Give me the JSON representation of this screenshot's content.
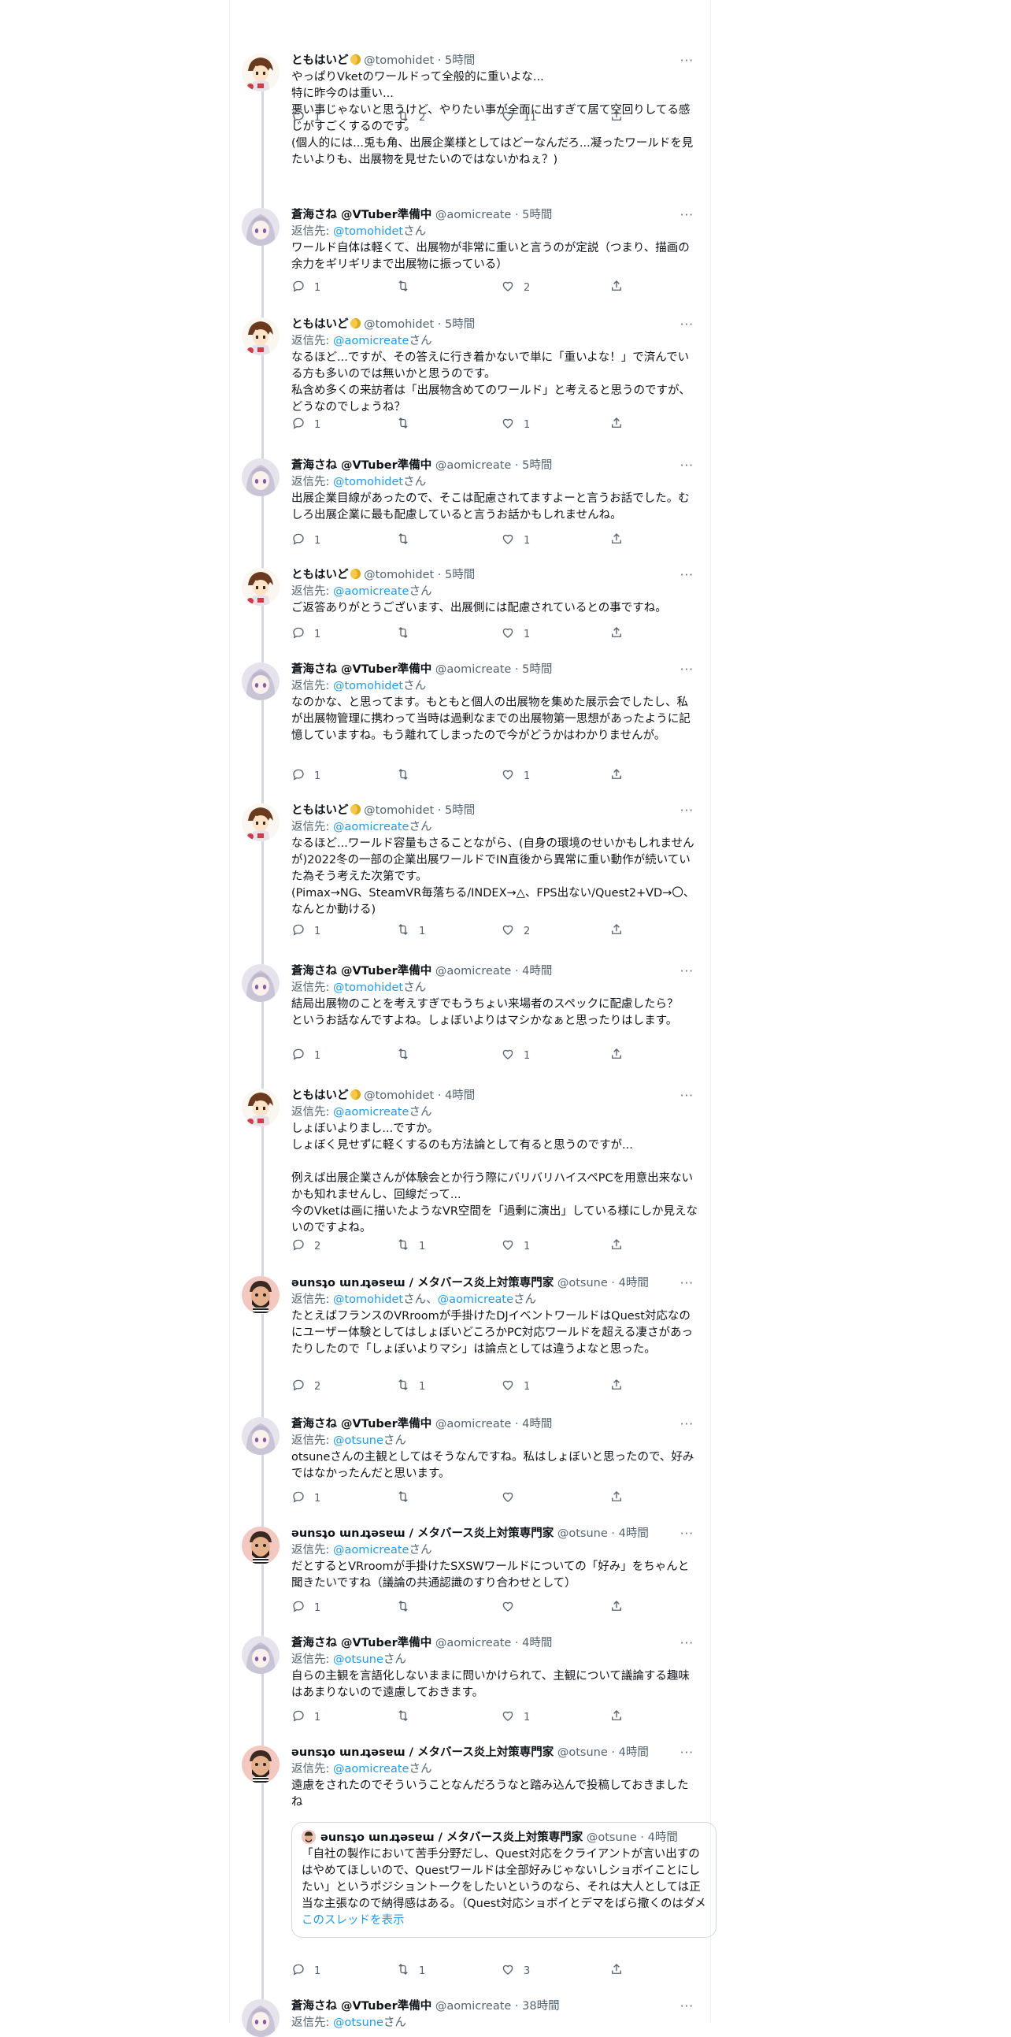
{
  "ui": {
    "reply_prefix": "返信先: ",
    "reply_suffix": "さん",
    "more_label": "···",
    "dot": "·"
  },
  "tweets": [
    {
      "name": "ともはいど",
      "has_moon": true,
      "handle": "@tomohidet",
      "time": "5時間",
      "reply_to": null,
      "body": "やっぱりVketのワールドって全般的に重いよな...\n特に昨今のは重い...\n悪い事じゃないと思うけど、やりたい事が全面に出すぎて居て空回りしてる感じがすごくするのです。\n(個人的には...兎も角、出展企業様としてはどーなんだろ...凝ったワールドを見たいよりも、出展物を見せたいのではないかねぇ？)",
      "replies": "1",
      "retweets": "2",
      "likes": "11"
    },
    {
      "name": "蒼海さね @VTuber準備中",
      "has_moon": false,
      "handle": "@aomicreate",
      "time": "5時間",
      "reply_to": "@tomohidet",
      "body": "ワールド自体は軽くて、出展物が非常に重いと言うのが定説（つまり、描画の余力をギリギリまで出展物に振っている）",
      "replies": "1",
      "retweets": "",
      "likes": "2"
    },
    {
      "name": "ともはいど",
      "has_moon": true,
      "handle": "@tomohidet",
      "time": "5時間",
      "reply_to": "@aomicreate",
      "body": "なるほど...ですが、その答えに行き着かないで単に「重いよな！」で済んでいる方も多いのでは無いかと思うのです。\n私含め多くの来訪者は「出展物含めてのワールド」と考えると思うのですが、どうなのでしょうね？",
      "replies": "1",
      "retweets": "",
      "likes": "1"
    },
    {
      "name": "蒼海さね @VTuber準備中",
      "has_moon": false,
      "handle": "@aomicreate",
      "time": "5時間",
      "reply_to": "@tomohidet",
      "body": "出展企業目線があったので、そこは配慮されてますよーと言うお話でした。むしろ出展企業に最も配慮していると言うお話かもしれませんね。",
      "replies": "1",
      "retweets": "",
      "likes": "1"
    },
    {
      "name": "ともはいど",
      "has_moon": true,
      "handle": "@tomohidet",
      "time": "5時間",
      "reply_to": "@aomicreate",
      "body": "ご返答ありがとうございます、出展側には配慮されているとの事ですね。",
      "replies": "1",
      "retweets": "",
      "likes": "1"
    },
    {
      "name": "蒼海さね @VTuber準備中",
      "has_moon": false,
      "handle": "@aomicreate",
      "time": "5時間",
      "reply_to": "@tomohidet",
      "body": "なのかな、と思ってます。もともと個人の出展物を集めた展示会でしたし、私が出展物管理に携わって当時は過剰なまでの出展物第一思想があったように記憶していますね。もう離れてしまったので今がどうかはわかりませんが。",
      "replies": "1",
      "retweets": "",
      "likes": "1"
    },
    {
      "name": "ともはいど",
      "has_moon": true,
      "handle": "@tomohidet",
      "time": "5時間",
      "reply_to": "@aomicreate",
      "body": "なるほど...ワールド容量もさることながら、(自身の環境のせいかもしれませんが)2022冬の一部の企業出展ワールドでIN直後から異常に重い動作が続いていた為そう考えた次第です。\n(Pimax→NG、SteamVR毎落ちる/INDEX→△、FPS出ない/Quest2+VD→〇、なんとか動ける)",
      "replies": "1",
      "retweets": "1",
      "likes": "2"
    },
    {
      "name": "蒼海さね @VTuber準備中",
      "has_moon": false,
      "handle": "@aomicreate",
      "time": "4時間",
      "reply_to": "@tomohidet",
      "body": "結局出展物のことを考えすぎでもうちょい来場者のスペックに配慮したら？　というお話なんですよね。しょぼいよりはマシかなぁと思ったりはします。",
      "replies": "1",
      "retweets": "",
      "likes": "1"
    },
    {
      "name": "ともはいど",
      "has_moon": true,
      "handle": "@tomohidet",
      "time": "4時間",
      "reply_to": "@aomicreate",
      "body": "しょぼいよりまし...ですか。\nしょぼく見せずに軽くするのも方法論として有ると思うのですが...\n\n例えば出展企業さんが体験会とか行う際にバリバリハイスペPCを用意出来ないかも知れませんし、回線だって...\n今のVketは画に描いたようなVR空間を「過剰に演出」している様にしか見えないのですよね。",
      "replies": "2",
      "retweets": "1",
      "likes": "1"
    },
    {
      "name": "ǝunsʇo ɯnɹʇǝsɐɯ / メタバース炎上対策専門家",
      "has_moon": false,
      "handle": "@otsune",
      "time": "4時間",
      "reply_to_multi": [
        "@tomohidet",
        "@aomicreate"
      ],
      "body": "たとえばフランスのVRroomが手掛けたDJイベントワールドはQuest対応なのにユーザー体験としてはしょぼいどころかPC対応ワールドを超える凄さがあったりしたので「しょぼいよりマシ」は論点としては違うよなと思った。",
      "replies": "2",
      "retweets": "1",
      "likes": "1"
    },
    {
      "name": "蒼海さね @VTuber準備中",
      "has_moon": false,
      "handle": "@aomicreate",
      "time": "4時間",
      "reply_to": "@otsune",
      "body": "otsuneさんの主観としてはそうなんですね。私はしょぼいと思ったので、好みではなかったんだと思います。",
      "replies": "1",
      "retweets": "",
      "likes": ""
    },
    {
      "name": "ǝunsʇo ɯnɹʇǝsɐɯ / メタバース炎上対策専門家",
      "has_moon": false,
      "handle": "@otsune",
      "time": "4時間",
      "reply_to": "@aomicreate",
      "body": "だとするとVRroomが手掛けたSXSWワールドについての「好み」をちゃんと聞きたいですね（議論の共通認識のすり合わせとして）",
      "replies": "1",
      "retweets": "",
      "likes": ""
    },
    {
      "name": "蒼海さね @VTuber準備中",
      "has_moon": false,
      "handle": "@aomicreate",
      "time": "4時間",
      "reply_to": "@otsune",
      "body": "自らの主観を言語化しないままに問いかけられて、主観について議論する趣味はあまりないので遠慮しておきます。",
      "replies": "1",
      "retweets": "",
      "likes": "1"
    },
    {
      "name": "ǝunsʇo ɯnɹʇǝsɐɯ / メタバース炎上対策専門家",
      "has_moon": false,
      "handle": "@otsune",
      "time": "4時間",
      "reply_to": "@aomicreate",
      "body": "遠慮をされたのでそういうことなんだろうなと踏み込んで投稿しておきましたね",
      "replies": "1",
      "retweets": "1",
      "likes": "3",
      "quote": {
        "name": "ǝunsʇo ɯnɹʇǝsɐɯ / メタバース炎上対策専門家",
        "handle": "@otsune",
        "time": "4時間",
        "body": "「自社の製作において苦手分野だし、Quest対応をクライアントが言い出すのはやめてほしいので、Questワールドは全部好みじゃないしショボイことにしたい」というポジショントークをしたいというのなら、それは大人としては正当な主張なので納得感はある。（Quest対応ショボイとデマをばら撒くのはダメ",
        "link": "このスレッドを表示"
      }
    },
    {
      "name": "蒼海さね @VTuber準備中",
      "has_moon": false,
      "handle": "@aomicreate",
      "time": "38時間",
      "reply_to": "@otsune",
      "body": "",
      "replies": "",
      "retweets": "",
      "likes": ""
    }
  ]
}
